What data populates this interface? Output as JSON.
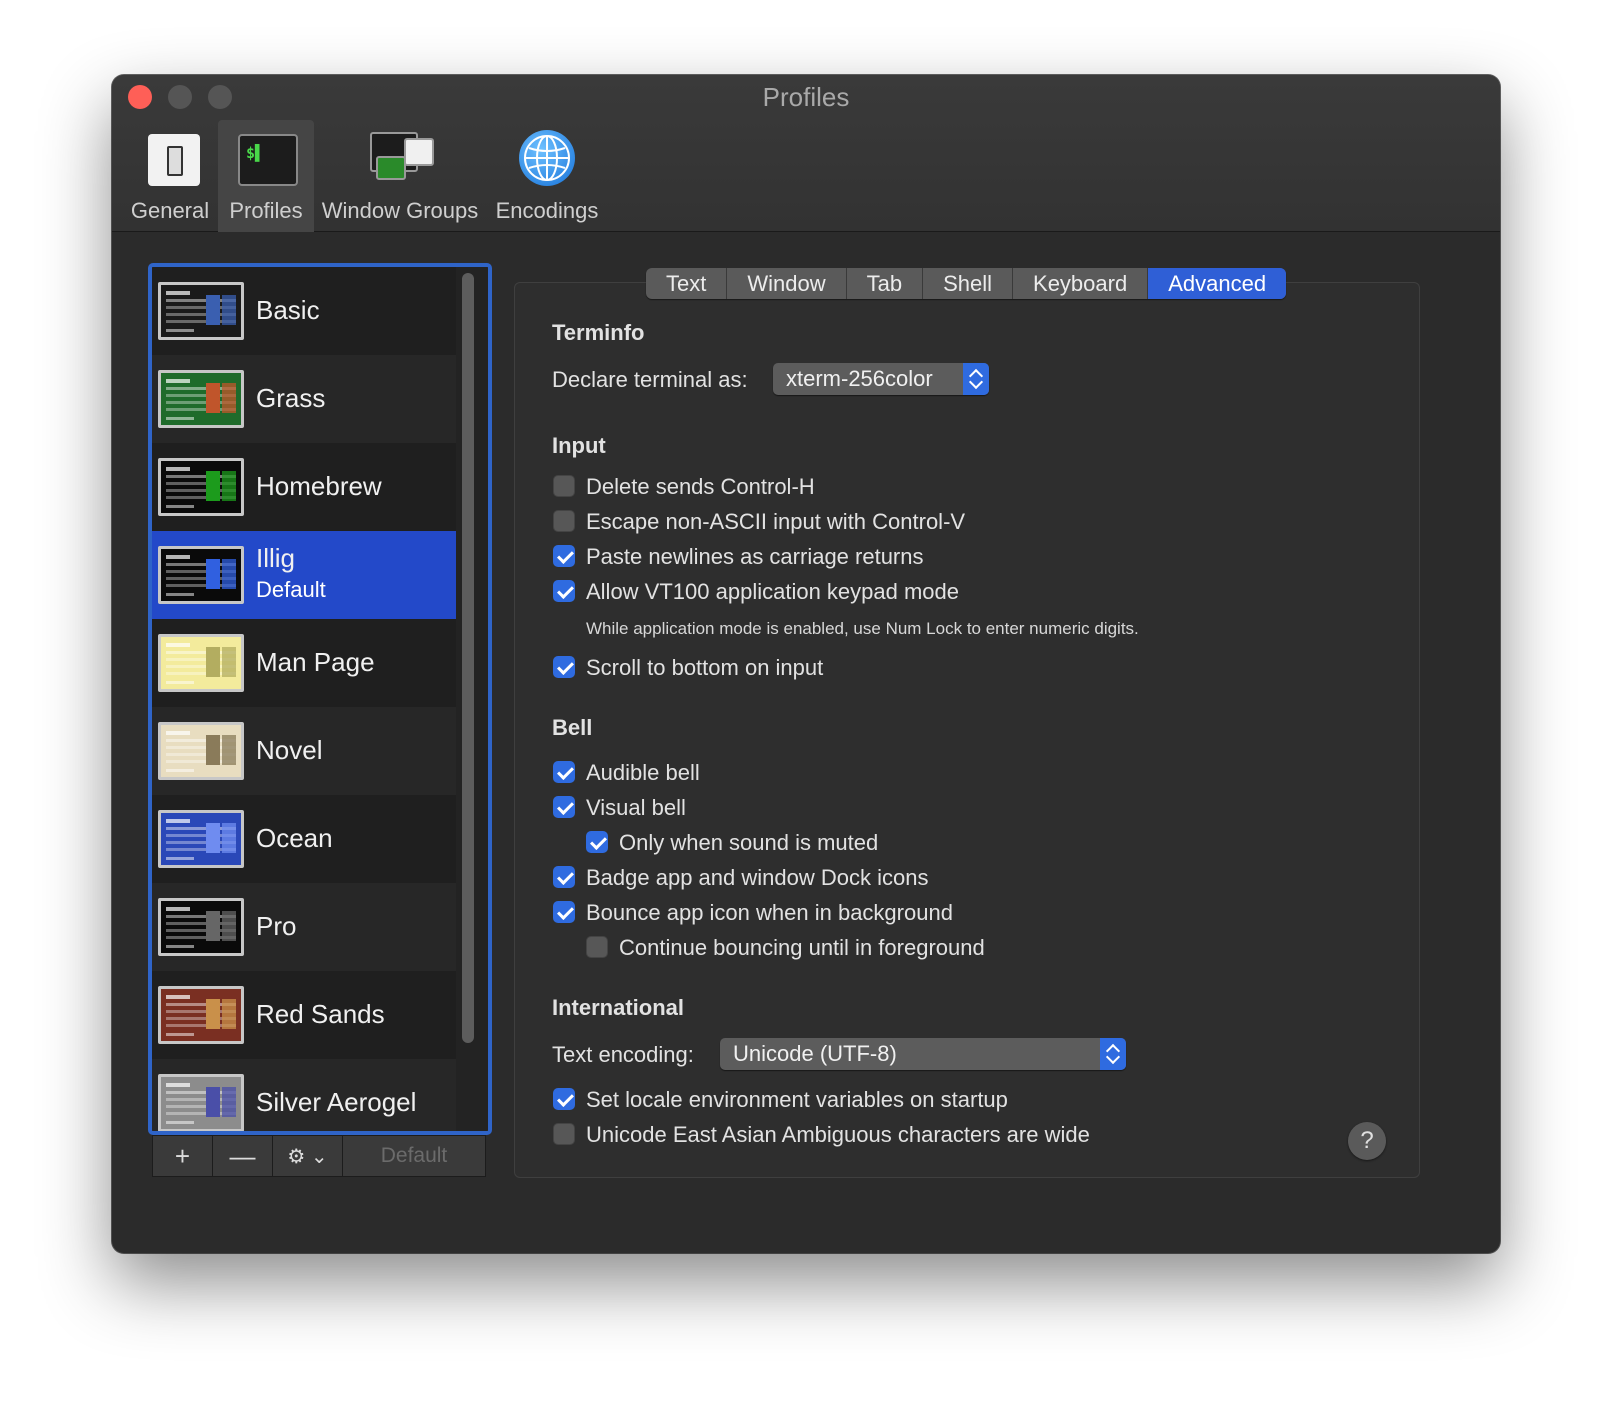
{
  "window": {
    "title": "Profiles"
  },
  "toolbar": {
    "items": [
      {
        "label": "General",
        "icon": "general-switch-icon"
      },
      {
        "label": "Profiles",
        "icon": "terminal-icon",
        "selected": true
      },
      {
        "label": "Window Groups",
        "icon": "window-groups-icon"
      },
      {
        "label": "Encodings",
        "icon": "globe-icon"
      }
    ]
  },
  "profiles": {
    "items": [
      {
        "name": "Basic",
        "colors": {
          "bg": "#1a1a1a",
          "hl": "#3a5fb0"
        }
      },
      {
        "name": "Grass",
        "colors": {
          "bg": "#1f6b2b",
          "hl": "#c0552b"
        }
      },
      {
        "name": "Homebrew",
        "colors": {
          "bg": "#0a0a0a",
          "hl": "#1c9b1c"
        }
      },
      {
        "name": "Illig",
        "subtitle": "Default",
        "colors": {
          "bg": "#0a0a0a",
          "hl": "#3060e0"
        }
      },
      {
        "name": "Man Page",
        "colors": {
          "bg": "#f3eb9c",
          "hl": "#b3ad60"
        }
      },
      {
        "name": "Novel",
        "colors": {
          "bg": "#e8ddc0",
          "hl": "#8a7b5a"
        }
      },
      {
        "name": "Ocean",
        "colors": {
          "bg": "#2a48b8",
          "hl": "#6f8cf0"
        }
      },
      {
        "name": "Pro",
        "colors": {
          "bg": "#0a0a0a",
          "hl": "#666666"
        }
      },
      {
        "name": "Red Sands",
        "colors": {
          "bg": "#7a2f22",
          "hl": "#c9904a"
        }
      },
      {
        "name": "Silver Aerogel",
        "colors": {
          "bg": "#8c8c8c",
          "hl": "#4a4fa8"
        }
      }
    ],
    "buttons": {
      "add": "+",
      "remove": "—",
      "default": "Default"
    }
  },
  "tabs": [
    "Text",
    "Window",
    "Tab",
    "Shell",
    "Keyboard",
    "Advanced"
  ],
  "active_tab": "Advanced",
  "terminfo": {
    "heading": "Terminfo",
    "declare_label": "Declare terminal as:",
    "declare_value": "xterm-256color"
  },
  "input": {
    "heading": "Input",
    "options": [
      {
        "label": "Delete sends Control-H",
        "checked": false
      },
      {
        "label": "Escape non-ASCII input with Control-V",
        "checked": false
      },
      {
        "label": "Paste newlines as carriage returns",
        "checked": true
      },
      {
        "label": "Allow VT100 application keypad mode",
        "checked": true
      }
    ],
    "note": "While application mode is enabled, use Num Lock to enter numeric digits.",
    "scroll_label": "Scroll to bottom on input",
    "scroll_checked": true
  },
  "bell": {
    "heading": "Bell",
    "options": [
      {
        "label": "Audible bell",
        "checked": true
      },
      {
        "label": "Visual bell",
        "checked": true
      },
      {
        "label": "Only when sound is muted",
        "checked": true
      },
      {
        "label": "Badge app and window Dock icons",
        "checked": true
      },
      {
        "label": "Bounce app icon when in background",
        "checked": true
      },
      {
        "label": "Continue bouncing until in foreground",
        "checked": false
      }
    ]
  },
  "international": {
    "heading": "International",
    "encoding_label": "Text encoding:",
    "encoding_value": "Unicode (UTF-8)",
    "options": [
      {
        "label": "Set locale environment variables on startup",
        "checked": true
      },
      {
        "label": "Unicode East Asian Ambiguous characters are wide",
        "checked": false
      }
    ]
  },
  "help": {
    "label": "?"
  },
  "colors": {
    "accent": "#2f6be0",
    "selection": "#2349c9",
    "close": "#fe5f57"
  }
}
